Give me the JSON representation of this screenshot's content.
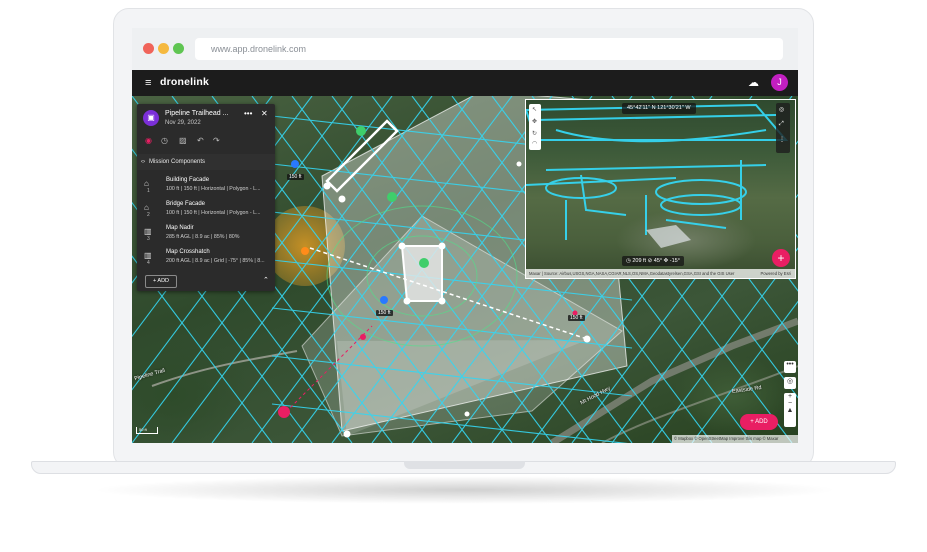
{
  "browser": {
    "url": "www.app.dronelink.com"
  },
  "app": {
    "brand": "dronelink",
    "avatar_initial": "J",
    "accent_color": "#e91e63",
    "mission_color": "#7b2fd8",
    "path_color": "#35d6f2"
  },
  "mission": {
    "title": "Pipeline Trailhead ...",
    "date": "Nov 29, 2022",
    "components_label": "Mission Components",
    "add_label": "+ ADD",
    "components": [
      {
        "num": "1",
        "icon": "building-icon",
        "title": "Building Facade",
        "desc": "100 ft | 150 ft | Horizontal | Polygon - L..."
      },
      {
        "num": "2",
        "icon": "bridge-icon",
        "title": "Bridge Facade",
        "desc": "100 ft | 150 ft | Horizontal | Polygon - L..."
      },
      {
        "num": "3",
        "icon": "map-icon",
        "title": "Map Nadir",
        "desc": "285 ft AGL | 8.9 ac | 85% | 80%"
      },
      {
        "num": "4",
        "icon": "map-icon",
        "title": "Map Crosshatch",
        "desc": "200 ft AGL | 8.9 ac | Grid | -75° | 85% | 8..."
      }
    ]
  },
  "pip": {
    "coords": "45°42'11\" N 121°30'21\" W",
    "altitude": "209 ft",
    "heading": "45°",
    "gimbal": "-15°",
    "attribution": "Maxar | Source: Airbus,USGS,NGA,NASA,CGIAR,NLS,OS,NMA,Geodatastyrelsen,GSA,GSI and the GIS User",
    "powered": "Powered by Esri"
  },
  "map": {
    "attribution": "© Mapbox © OpenStreetMap  Improve this map  © Maxar",
    "scale": "50 ft",
    "roads": [
      "Pipeline Trail",
      "Eastside Rd",
      "Mt Hood Hwy"
    ],
    "altitude_labels": [
      "150 ft",
      "150 ft",
      "150 ft"
    ],
    "add_label": "+ ADD",
    "fab_plus": "+"
  }
}
